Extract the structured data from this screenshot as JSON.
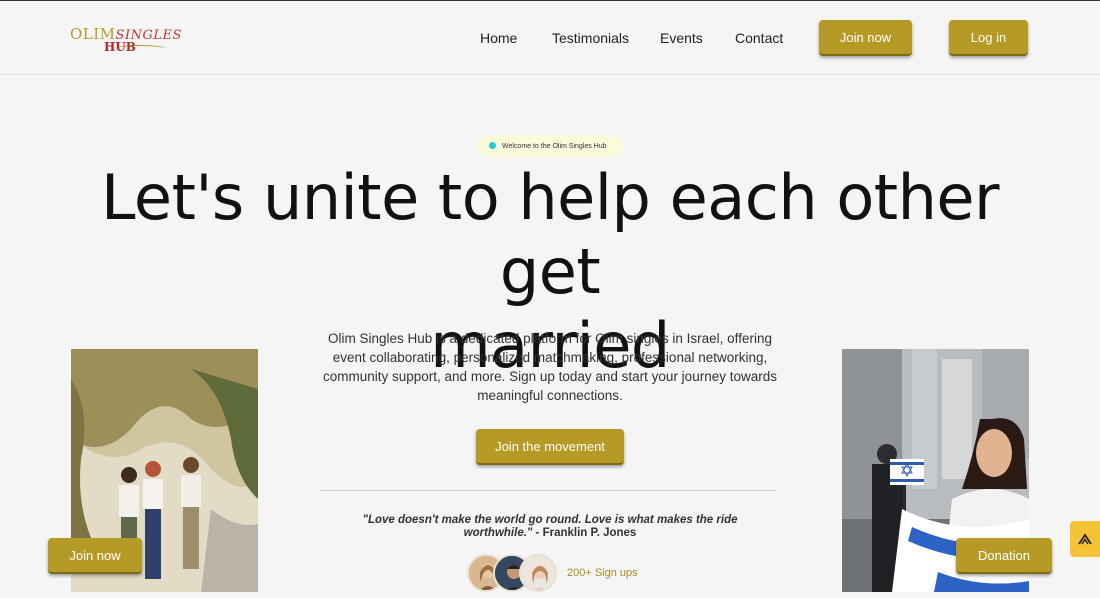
{
  "logo": {
    "line1": "OLIM",
    "line1_italic": "SINGLES",
    "line2": "HUB"
  },
  "nav": {
    "home": "Home",
    "testimonials": "Testimonials",
    "events": "Events",
    "contact": "Contact"
  },
  "header_buttons": {
    "join": "Join now",
    "login": "Log in"
  },
  "hero": {
    "badge": "Welcome to the Olim Singles Hub",
    "headline_line1": "Let's unite to help each other get",
    "headline_line2": "married",
    "description": "Olim Singles Hub is a dedicated platform for Olim singles in Israel, offering event collaborating, personalized matchmaking, professional networking, community support, and more. Sign up today and start your journey towards meaningful connections.",
    "cta": "Join the movement"
  },
  "quote": {
    "text": "\"Love doesn't make the world go round. Love is what makes the ride worthwhile.\"",
    "author": " - Franklin P. Jones"
  },
  "signups": "200+ Sign ups",
  "floating": {
    "join": "Join now",
    "donation": "Donation"
  },
  "colors": {
    "accent": "#b59a26",
    "background": "#f5f5f6",
    "badge_bg": "#fbfbd9",
    "scroll_button": "#f6c238"
  },
  "icons": {
    "scroll_top": "chevron-up-icon"
  }
}
